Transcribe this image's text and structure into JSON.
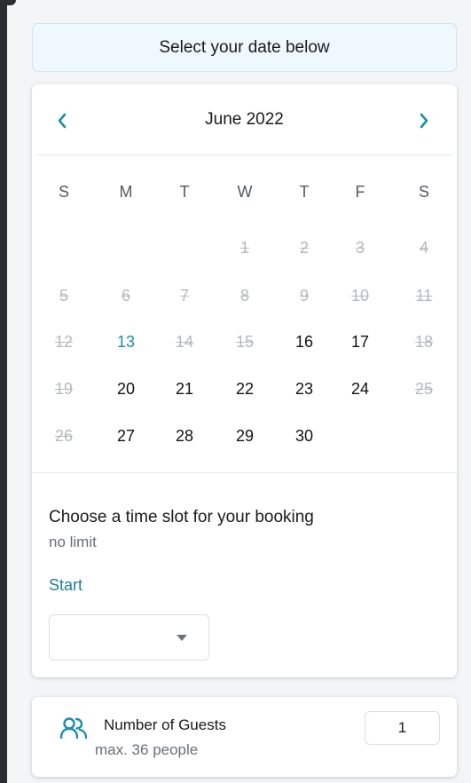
{
  "header": {
    "title": "Select your date below"
  },
  "calendar": {
    "month_label": "June 2022",
    "weekdays": [
      "S",
      "M",
      "T",
      "W",
      "T",
      "F",
      "S"
    ],
    "days": [
      {
        "label": "1",
        "col": 3,
        "row": 0,
        "state": "disabled"
      },
      {
        "label": "2",
        "col": 4,
        "row": 0,
        "state": "disabled"
      },
      {
        "label": "3",
        "col": 5,
        "row": 0,
        "state": "disabled"
      },
      {
        "label": "4",
        "col": 6,
        "row": 0,
        "state": "disabled"
      },
      {
        "label": "5",
        "col": 0,
        "row": 1,
        "state": "disabled"
      },
      {
        "label": "6",
        "col": 1,
        "row": 1,
        "state": "disabled"
      },
      {
        "label": "7",
        "col": 2,
        "row": 1,
        "state": "disabled"
      },
      {
        "label": "8",
        "col": 3,
        "row": 1,
        "state": "disabled"
      },
      {
        "label": "9",
        "col": 4,
        "row": 1,
        "state": "disabled"
      },
      {
        "label": "10",
        "col": 5,
        "row": 1,
        "state": "disabled"
      },
      {
        "label": "11",
        "col": 6,
        "row": 1,
        "state": "disabled"
      },
      {
        "label": "12",
        "col": 0,
        "row": 2,
        "state": "disabled"
      },
      {
        "label": "13",
        "col": 1,
        "row": 2,
        "state": "today"
      },
      {
        "label": "14",
        "col": 2,
        "row": 2,
        "state": "disabled"
      },
      {
        "label": "15",
        "col": 3,
        "row": 2,
        "state": "disabled"
      },
      {
        "label": "16",
        "col": 4,
        "row": 2,
        "state": "available"
      },
      {
        "label": "17",
        "col": 5,
        "row": 2,
        "state": "available"
      },
      {
        "label": "18",
        "col": 6,
        "row": 2,
        "state": "disabled"
      },
      {
        "label": "19",
        "col": 0,
        "row": 3,
        "state": "disabled"
      },
      {
        "label": "20",
        "col": 1,
        "row": 3,
        "state": "available"
      },
      {
        "label": "21",
        "col": 2,
        "row": 3,
        "state": "available"
      },
      {
        "label": "22",
        "col": 3,
        "row": 3,
        "state": "available"
      },
      {
        "label": "23",
        "col": 4,
        "row": 3,
        "state": "available"
      },
      {
        "label": "24",
        "col": 5,
        "row": 3,
        "state": "available"
      },
      {
        "label": "25",
        "col": 6,
        "row": 3,
        "state": "disabled"
      },
      {
        "label": "26",
        "col": 0,
        "row": 4,
        "state": "disabled"
      },
      {
        "label": "27",
        "col": 1,
        "row": 4,
        "state": "available"
      },
      {
        "label": "28",
        "col": 2,
        "row": 4,
        "state": "available"
      },
      {
        "label": "29",
        "col": 3,
        "row": 4,
        "state": "available"
      },
      {
        "label": "30",
        "col": 4,
        "row": 4,
        "state": "available"
      }
    ]
  },
  "time_slot": {
    "title": "Choose a time slot for your booking",
    "subtitle": "no limit",
    "start_label": "Start",
    "start_value": ""
  },
  "guests": {
    "label": "Number of Guests",
    "max_text": "max. 36 people",
    "value": "1"
  },
  "colors": {
    "accent": "#1b8fa8",
    "disabled": "#b5b9be",
    "header_bg": "#eef8fd"
  },
  "icons": {
    "prev": "chevron-left-icon",
    "next": "chevron-right-icon",
    "guests": "users-icon",
    "select": "caret-down-icon"
  }
}
